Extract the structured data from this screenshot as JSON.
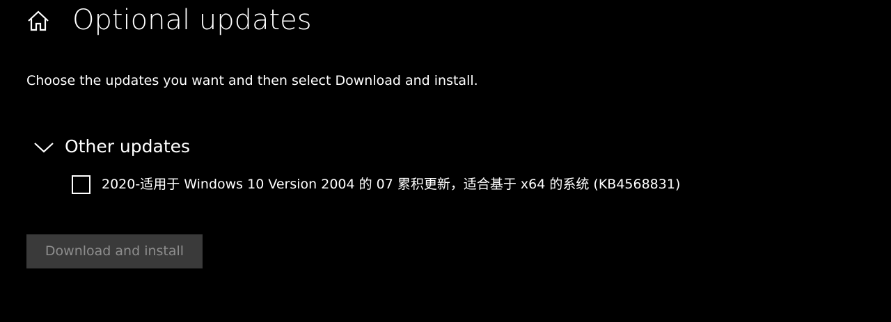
{
  "header": {
    "home_icon": "home-icon",
    "title": "Optional updates"
  },
  "description": "Choose the updates you want and then select Download and install.",
  "section": {
    "expanded": true,
    "chevron_icon": "chevron-down-icon",
    "title": "Other updates",
    "items": [
      {
        "checked": false,
        "label": "2020-适用于 Windows 10 Version 2004 的 07 累积更新，适合基于 x64 的系统 (KB4568831)"
      }
    ]
  },
  "download_button": {
    "label": "Download and install",
    "enabled": false
  },
  "colors": {
    "background": "#000000",
    "text": "#ffffff",
    "button_disabled_bg": "#3a3a3a",
    "button_disabled_text": "#8e8e8e"
  }
}
